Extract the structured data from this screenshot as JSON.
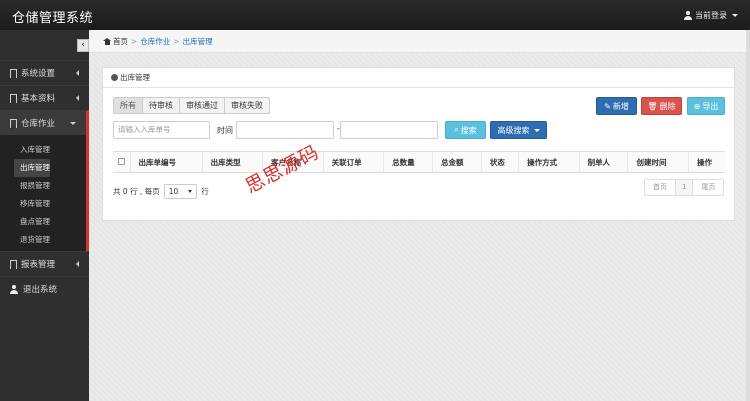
{
  "app": {
    "title": "仓储管理系统"
  },
  "user": {
    "label": "当前登录"
  },
  "sidebar": {
    "collapse_glyph": "‹",
    "items": [
      {
        "label": "系统设置",
        "icon": "bookmark-icon",
        "expanded": false
      },
      {
        "label": "基本资料",
        "icon": "bookmark-icon",
        "expanded": false
      },
      {
        "label": "仓库作业",
        "icon": "bookmark-icon",
        "expanded": true
      },
      {
        "label": "报表管理",
        "icon": "bookmark-icon",
        "expanded": false
      },
      {
        "label": "退出系统",
        "icon": "user-icon",
        "expanded": false
      }
    ],
    "subitems": [
      {
        "label": "入库管理",
        "current": false
      },
      {
        "label": "出库管理",
        "current": true
      },
      {
        "label": "报损管理",
        "current": false
      },
      {
        "label": "移库管理",
        "current": false
      },
      {
        "label": "盘点管理",
        "current": false
      },
      {
        "label": "退货管理",
        "current": false
      }
    ]
  },
  "breadcrumb": {
    "home": "首页",
    "section": "仓库作业",
    "page": "出库管理",
    "separator": ">"
  },
  "panel": {
    "title": "出库管理"
  },
  "tabs": [
    {
      "label": "所有",
      "active": true
    },
    {
      "label": "待审核",
      "active": false
    },
    {
      "label": "审核通过",
      "active": false
    },
    {
      "label": "审核失败",
      "active": false
    }
  ],
  "toolbar": {
    "new_label": "新增",
    "delete_label": "删除",
    "export_label": "导出"
  },
  "search": {
    "order_placeholder": "请输入入库单号",
    "time_label": "时间",
    "range_separator": "-",
    "search_label": "搜索",
    "advanced_label": "高级搜索"
  },
  "table": {
    "columns": [
      "出库单编号",
      "出库类型",
      "客户名称",
      "关联订单",
      "总数量",
      "总金额",
      "状态",
      "操作方式",
      "制单人",
      "创建时间",
      "操作"
    ]
  },
  "pagination": {
    "summary_prefix": "共 0 行 , 每页",
    "page_size": "10",
    "summary_suffix": "行",
    "first": "首页",
    "current": "1",
    "last": "尾页"
  },
  "watermark": "思思源码",
  "colors": {
    "primary": "#2f6db3",
    "danger": "#d9534f",
    "info": "#5bc0de",
    "sidebar": "#2f2f2f",
    "accent": "#d9332c"
  }
}
